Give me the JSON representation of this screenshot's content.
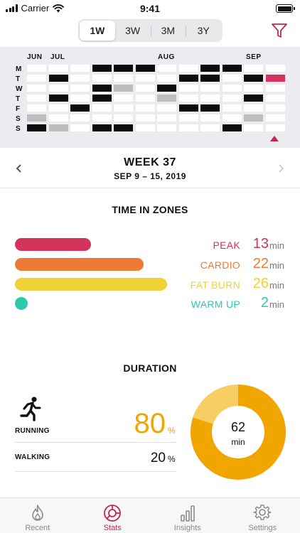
{
  "status": {
    "carrier": "Carrier",
    "time": "9:41"
  },
  "range_tabs": [
    {
      "label": "1W",
      "active": true
    },
    {
      "label": "3W",
      "active": false
    },
    {
      "label": "3M",
      "active": false
    },
    {
      "label": "3Y",
      "active": false
    }
  ],
  "calendar": {
    "months": [
      "JUN",
      "JUL",
      "AUG",
      "SEP"
    ],
    "days": [
      "M",
      "T",
      "W",
      "T",
      "F",
      "S",
      "S"
    ],
    "legend": {
      "b": "#0c0c0c",
      "g": "#bdbdbd",
      "r": "#d4335c",
      "w": "#ffffff"
    },
    "weeks": [
      "wwwwwgb",
      "wbwbwwg",
      "wwwwbww",
      "bwbbwwb",
      "bwgwwwb",
      "bwwwwww",
      "wwbgwww",
      "wbwwbww",
      "bbwwbww",
      "bwwwwwb",
      "wbwbwgw",
      "wrwwwww"
    ],
    "accent": "#c0294f"
  },
  "week": {
    "title": "WEEK 37",
    "range": "SEP 9 – 15, 2019"
  },
  "zones": {
    "title": "TIME IN ZONES",
    "unit": "min",
    "items": [
      {
        "label": "PEAK",
        "value": "13",
        "minutes": 13,
        "color": "#d4335c"
      },
      {
        "label": "CARDIO",
        "value": "22",
        "minutes": 22,
        "color": "#ef7a35"
      },
      {
        "label": "FAT BURN",
        "value": "26",
        "minutes": 26,
        "color": "#efd235"
      },
      {
        "label": "WARM UP",
        "value": "2",
        "minutes": 2,
        "color": "#2dc9ac"
      }
    ]
  },
  "duration": {
    "title": "DURATION",
    "total_value": "62",
    "total_unit": "min",
    "percent_symbol": "%",
    "running": {
      "label": "RUNNING",
      "value": "80",
      "fraction": 0.8,
      "color": "#f0a500"
    },
    "walking": {
      "label": "WALKING",
      "value": "20",
      "fraction": 0.2,
      "color": "#f7ce63"
    }
  },
  "tabs": [
    {
      "label": "Recent",
      "icon": "flame-icon",
      "active": false
    },
    {
      "label": "Stats",
      "icon": "stats-wheel-icon",
      "active": true
    },
    {
      "label": "Insights",
      "icon": "bar-chart-icon",
      "active": false
    },
    {
      "label": "Settings",
      "icon": "gear-icon",
      "active": false
    }
  ]
}
